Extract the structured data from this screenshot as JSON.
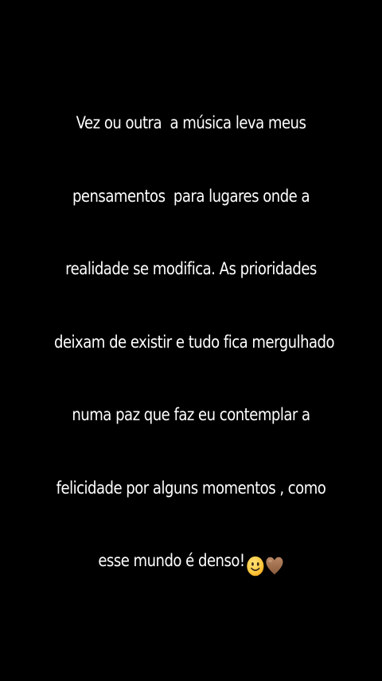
{
  "story": {
    "background_color": "#000000",
    "text_color": "#ffffff",
    "lines": [
      "Vez ou outra  a música leva meus",
      "pensamentos  para lugares onde a",
      "realidade se modifica. As prioridades",
      "deixam de existir e tudo fica mergulhado",
      "numa paz que faz eu contemplar a",
      "felicidade por alguns momentos , como",
      "esse mundo é denso!"
    ],
    "trailing_emojis": [
      "smiling-face-icon",
      "brown-heart-icon"
    ],
    "emoji_colors": {
      "smile_face": "#FFC83D",
      "smile_features": "#3D2A14",
      "brown_heart": "#A0714F"
    }
  }
}
